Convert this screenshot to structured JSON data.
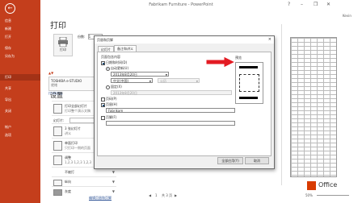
{
  "window": {
    "title": "Fabrikam Furniture - PowerPoint",
    "user": "Kevin"
  },
  "nav": {
    "items": [
      {
        "label": "信息"
      },
      {
        "label": "新建"
      },
      {
        "label": "打开"
      },
      {
        "label": "保存"
      },
      {
        "label": "另存为"
      },
      {
        "label": "打印"
      },
      {
        "label": "共享"
      },
      {
        "label": "导出"
      },
      {
        "label": "关闭"
      },
      {
        "label": "帐户"
      },
      {
        "label": "选项"
      }
    ]
  },
  "print": {
    "heading": "打印",
    "print_button": "打印",
    "copies_label": "份数:",
    "copies_value": "1",
    "printer_name": "TOSHIBA e-STUDIO",
    "printer_status": "就绪",
    "printer_props": "打印机属性",
    "settings_heading": "设置",
    "settings": [
      {
        "title": "打印全部幻灯片",
        "sub": "打印整个演示文稿"
      },
      {
        "title": "幻灯片:",
        "sub": ""
      },
      {
        "title": "3 张幻灯片",
        "sub": "讲义"
      },
      {
        "title": "单面打印",
        "sub": "只打印一侧的页面"
      },
      {
        "title": "调整",
        "sub": "1,2,3  1,2,3  1,2,3"
      },
      {
        "title": "不被打",
        "sub": ""
      },
      {
        "title": "纵向",
        "sub": ""
      },
      {
        "title": "灰度",
        "sub": ""
      }
    ],
    "edit_link": "编辑页眉和页脚"
  },
  "dialog": {
    "title": "页眉和页脚",
    "close": "×",
    "tabs": [
      "幻灯片",
      "备注和讲义"
    ],
    "active_tab": 1,
    "section_label": "页面包含内容",
    "date_label": "日期和时间(D)",
    "auto_update_label": "自动更新(U)",
    "date_value": "2013年8月20日",
    "language_value": "中文(中国)",
    "calendar_value": "公历",
    "fixed_label": "固定(X)",
    "fixed_value": "2013年8月20日",
    "page_number_label": "页码(P)",
    "header_label": "页眉(H)",
    "header_value": "Fabrikam",
    "footer_label": "页脚(F)",
    "preview_label": "预览",
    "apply_all_button": "全部应用(Y)",
    "cancel_button": "取消"
  },
  "status": {
    "page_current": "1",
    "page_total": "共 3 页",
    "zoom": "50%"
  },
  "brand": {
    "office": "Office"
  },
  "colors": {
    "accent": "#c43e1c",
    "arrow": "#e31b23"
  }
}
